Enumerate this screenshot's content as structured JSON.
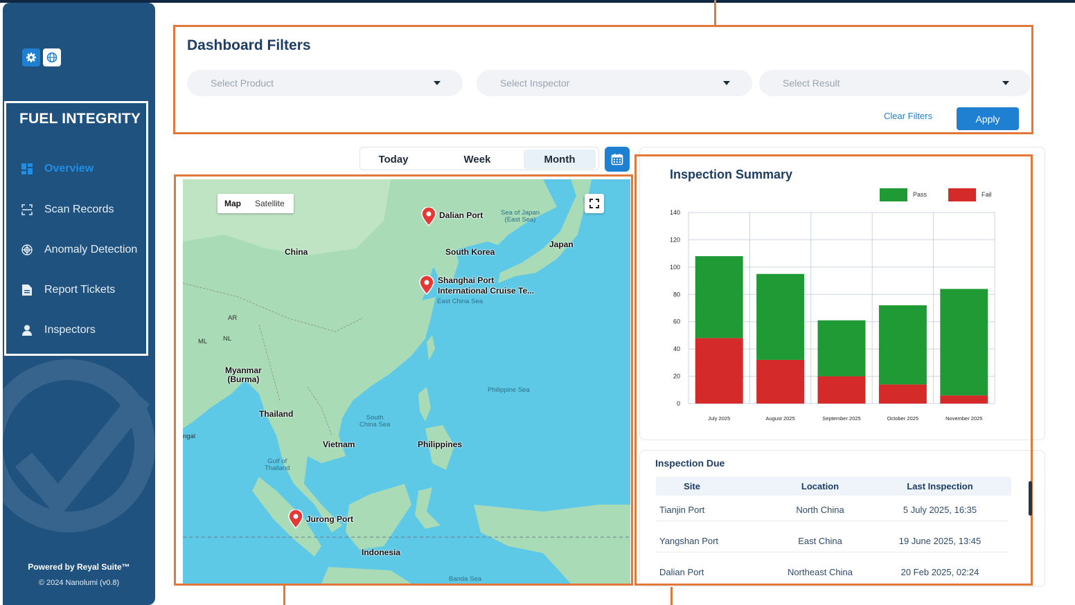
{
  "sidebar": {
    "brand": "FUEL INTEGRITY",
    "nav": [
      {
        "label": "Overview",
        "icon": "dashboard-icon",
        "active": true
      },
      {
        "label": "Scan Records",
        "icon": "scan-icon"
      },
      {
        "label": "Anomaly Detection",
        "icon": "radar-icon"
      },
      {
        "label": "Report Tickets",
        "icon": "document-icon"
      },
      {
        "label": "Inspectors",
        "icon": "user-icon"
      }
    ],
    "powered_by": "Powered by Reyal Suite™",
    "copyright": "© 2024 Nanolumi (v0.8)"
  },
  "filters": {
    "title": "Dashboard Filters",
    "product_placeholder": "Select Product",
    "inspector_placeholder": "Select Inspector",
    "result_placeholder": "Select Result",
    "clear_label": "Clear Filters",
    "apply_label": "Apply"
  },
  "period": {
    "options": [
      "Today",
      "Week",
      "Month"
    ],
    "selected": "Month"
  },
  "map": {
    "toggle": [
      "Map",
      "Satellite"
    ],
    "countries": [
      "China",
      "South Korea",
      "Japan",
      "Myanmar\n(Burma)",
      "Thailand",
      "Vietnam",
      "Philippines",
      "Indonesia"
    ],
    "seas": [
      "Sea of Japan\n(East Sea)",
      "East China Sea",
      "Philippine Sea",
      "South\nChina Sea",
      "Gulf of\nThailand",
      "Banda Sea"
    ],
    "fragments": [
      "AR",
      "ML",
      "NL",
      "ngal"
    ],
    "pins": [
      {
        "label": "Dalian Port"
      },
      {
        "label": "Shanghai Port\nInternational Cruise Te..."
      },
      {
        "label": "Jurong Port"
      }
    ]
  },
  "summary": {
    "title": "Inspection Summary"
  },
  "chart_data": {
    "type": "bar",
    "stacked": true,
    "title": "Inspection Summary",
    "categories": [
      "July 2025",
      "August 2025",
      "September 2025",
      "October 2025",
      "November 2025"
    ],
    "series": [
      {
        "name": "Fail",
        "color": "#d42a2a",
        "values": [
          48,
          32,
          20,
          14,
          6
        ]
      },
      {
        "name": "Pass",
        "color": "#1f9a34",
        "values": [
          60,
          63,
          41,
          58,
          78
        ]
      }
    ],
    "legend_order": [
      "Pass",
      "Fail"
    ],
    "ylim": [
      0,
      140
    ],
    "yticks": [
      0,
      20,
      40,
      60,
      80,
      100,
      120,
      140
    ],
    "grid": true,
    "legend": "top-right"
  },
  "inspection_due": {
    "title": "Inspection Due",
    "columns": [
      "Site",
      "Location",
      "Last Inspection"
    ],
    "rows": [
      [
        "Tianjin Port",
        "North China",
        "5 July 2025, 16:35"
      ],
      [
        "Yangshan Port",
        "East China",
        "19 June 2025, 13:45"
      ],
      [
        "Dalian Port",
        "Northeast China",
        "20 Feb 2025, 02:24"
      ]
    ]
  }
}
